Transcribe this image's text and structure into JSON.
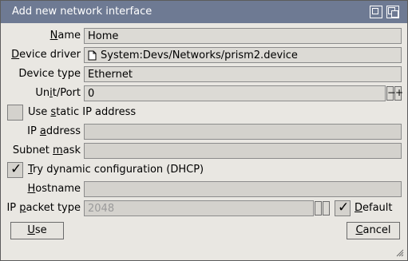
{
  "window": {
    "title": "Add new network interface"
  },
  "fields": {
    "name": {
      "label_pre": "",
      "label_u": "N",
      "label_post": "ame",
      "value": "Home"
    },
    "device_driver": {
      "label_pre": "",
      "label_u": "D",
      "label_post": "evice driver",
      "value": "System:Devs/Networks/prism2.device"
    },
    "device_type": {
      "label": "Device type",
      "value": "Ethernet"
    },
    "unit_port": {
      "label_pre": "Un",
      "label_u": "i",
      "label_post": "t/Port",
      "value": "0",
      "minus": "−",
      "plus": "+"
    },
    "static_ip": {
      "label_pre": "Use ",
      "label_u": "s",
      "label_post": "tatic IP address",
      "checked": false
    },
    "ip_address": {
      "label_pre": "IP ",
      "label_u": "a",
      "label_post": "ddress",
      "value": ""
    },
    "subnet_mask": {
      "label_pre": "Subnet ",
      "label_u": "m",
      "label_post": "ask",
      "value": ""
    },
    "dhcp": {
      "label_pre": "",
      "label_u": "T",
      "label_post": "ry dynamic configuration (DHCP)",
      "checked": true,
      "mark": "✓"
    },
    "hostname": {
      "label_pre": "",
      "label_u": "H",
      "label_post": "ostname",
      "value": ""
    },
    "ip_packet_type": {
      "label_pre": "IP ",
      "label_u": "p",
      "label_post": "acket type",
      "value": "2048"
    },
    "default_chk": {
      "label_pre": "",
      "label_u": "D",
      "label_post": "efault",
      "checked": true,
      "mark": "✓"
    }
  },
  "buttons": {
    "use": {
      "label_pre": "",
      "label_u": "U",
      "label_post": "se"
    },
    "cancel": {
      "label_pre": "",
      "label_u": "C",
      "label_post": "ancel"
    }
  },
  "colors": {
    "titlebar": "#6e7a93",
    "window_bg": "#e9e7e2",
    "field_bg": "#dcdad5"
  }
}
